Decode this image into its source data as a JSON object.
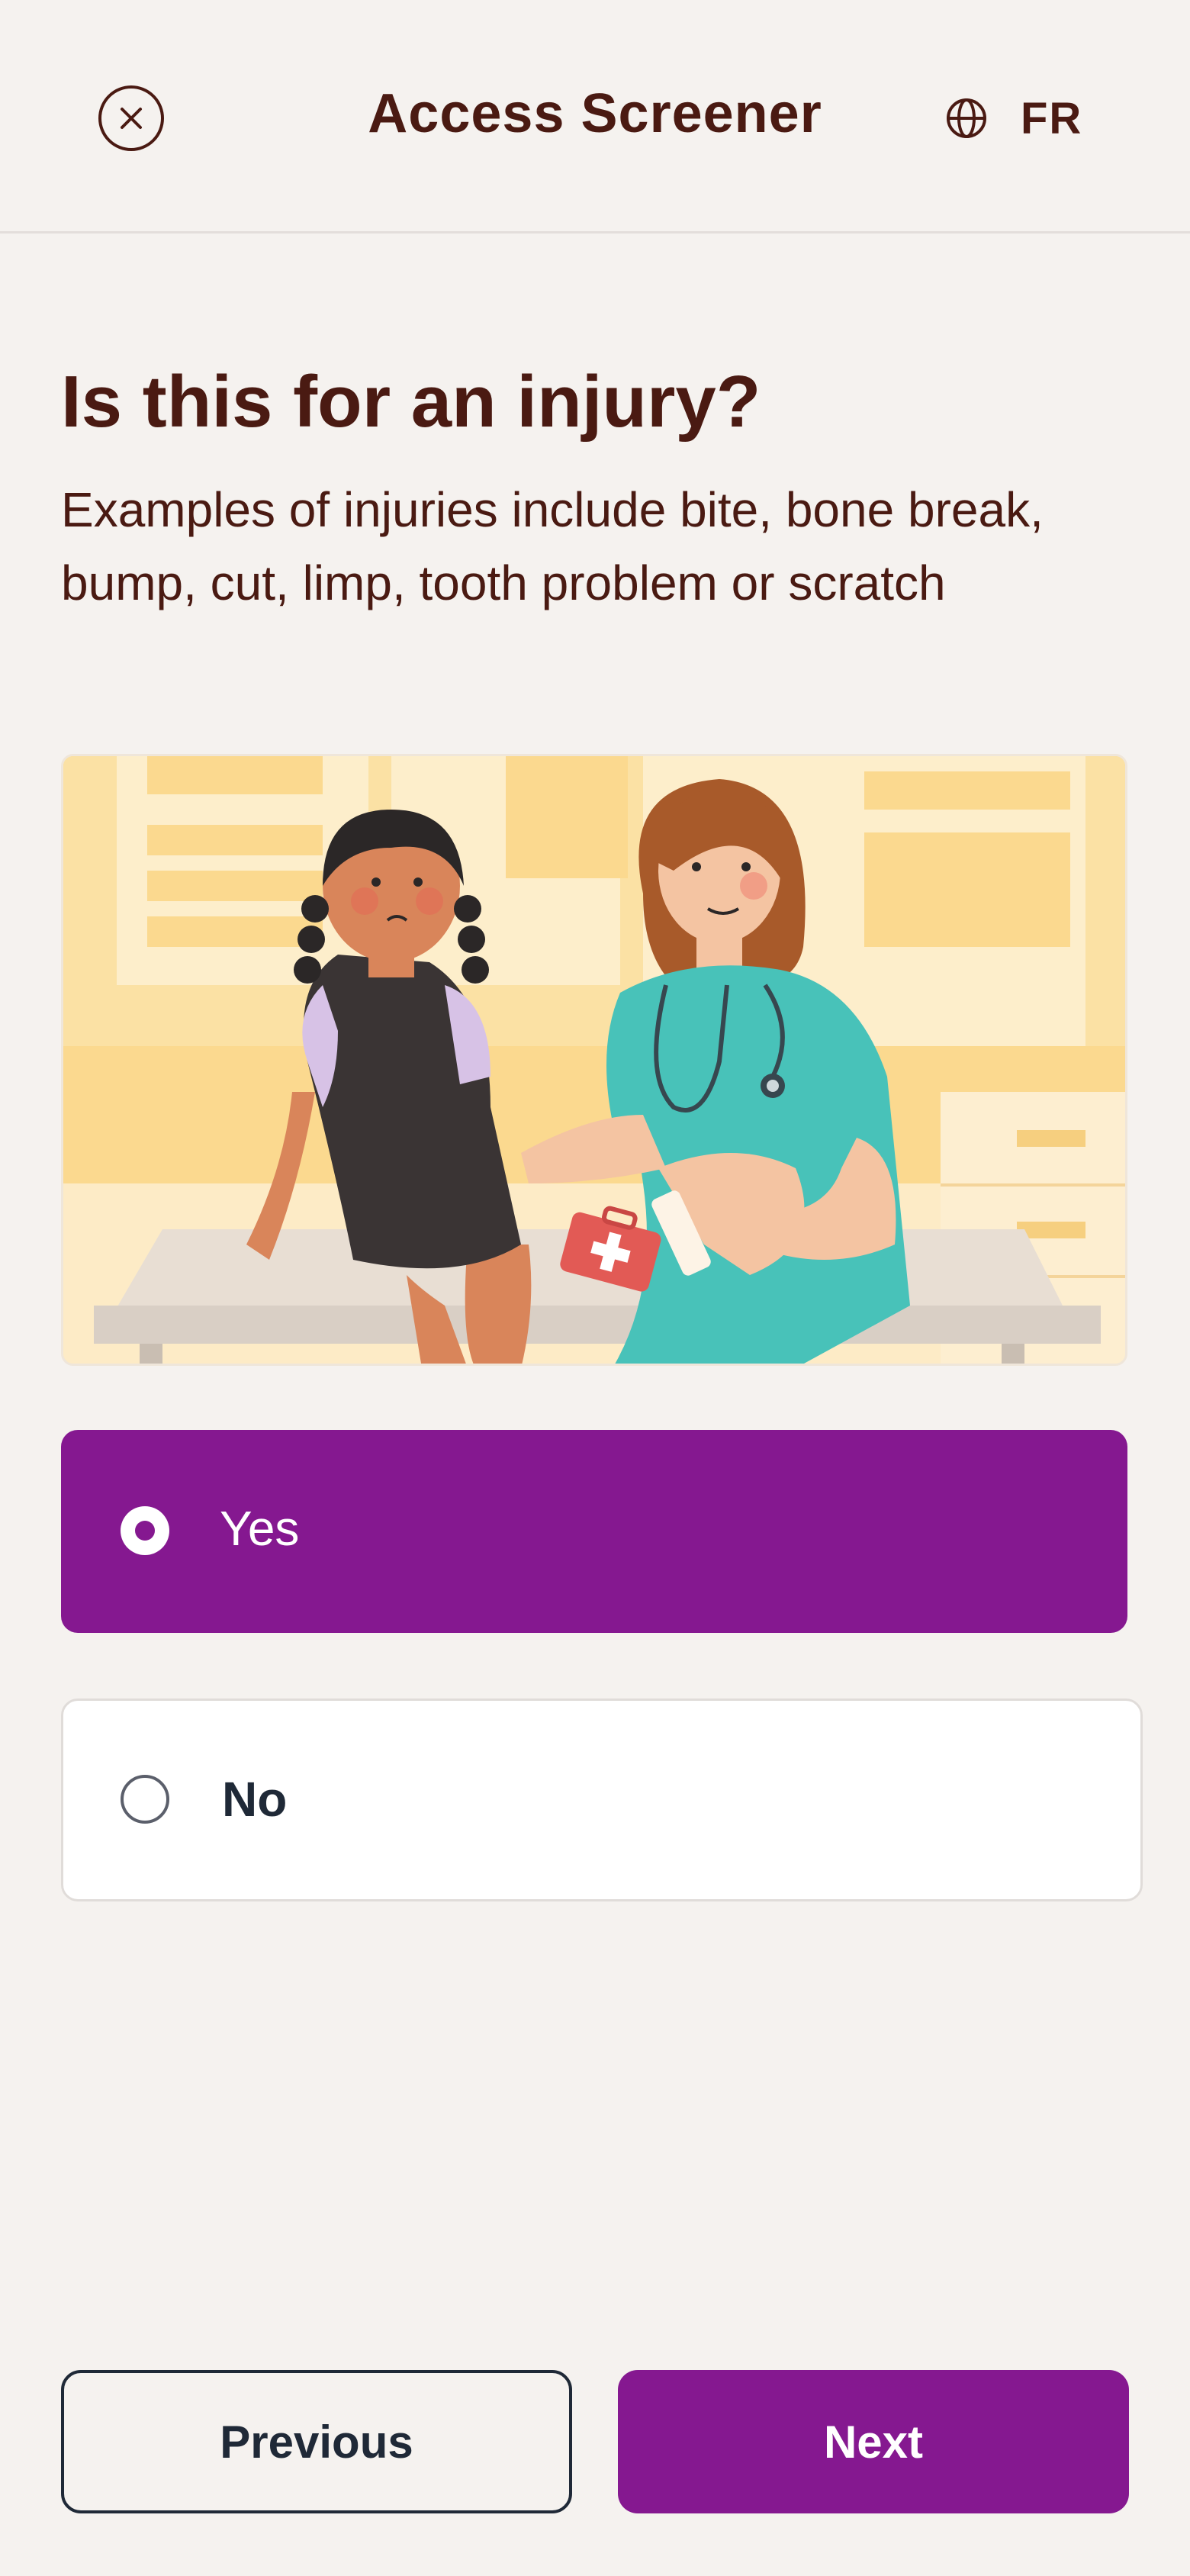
{
  "header": {
    "title": "Access Screener",
    "language_label": "FR"
  },
  "question": {
    "title": "Is this for an injury?",
    "description": "Examples of injuries include bite, bone break, bump, cut, limp, tooth problem or scratch"
  },
  "illustration": {
    "subject": "nurse-treating-child-illustration"
  },
  "options": [
    {
      "label": "Yes",
      "selected": true
    },
    {
      "label": "No",
      "selected": false
    }
  ],
  "navigation": {
    "previous_label": "Previous",
    "next_label": "Next"
  },
  "colors": {
    "background": "#f5f2ef",
    "primary": "#851890",
    "text": "#4a1a12",
    "dark": "#1f2937"
  },
  "icons": {
    "close": "close-icon",
    "language": "globe-icon",
    "radio_selected": "radio-selected-icon",
    "radio_unselected": "radio-unselected-icon"
  }
}
